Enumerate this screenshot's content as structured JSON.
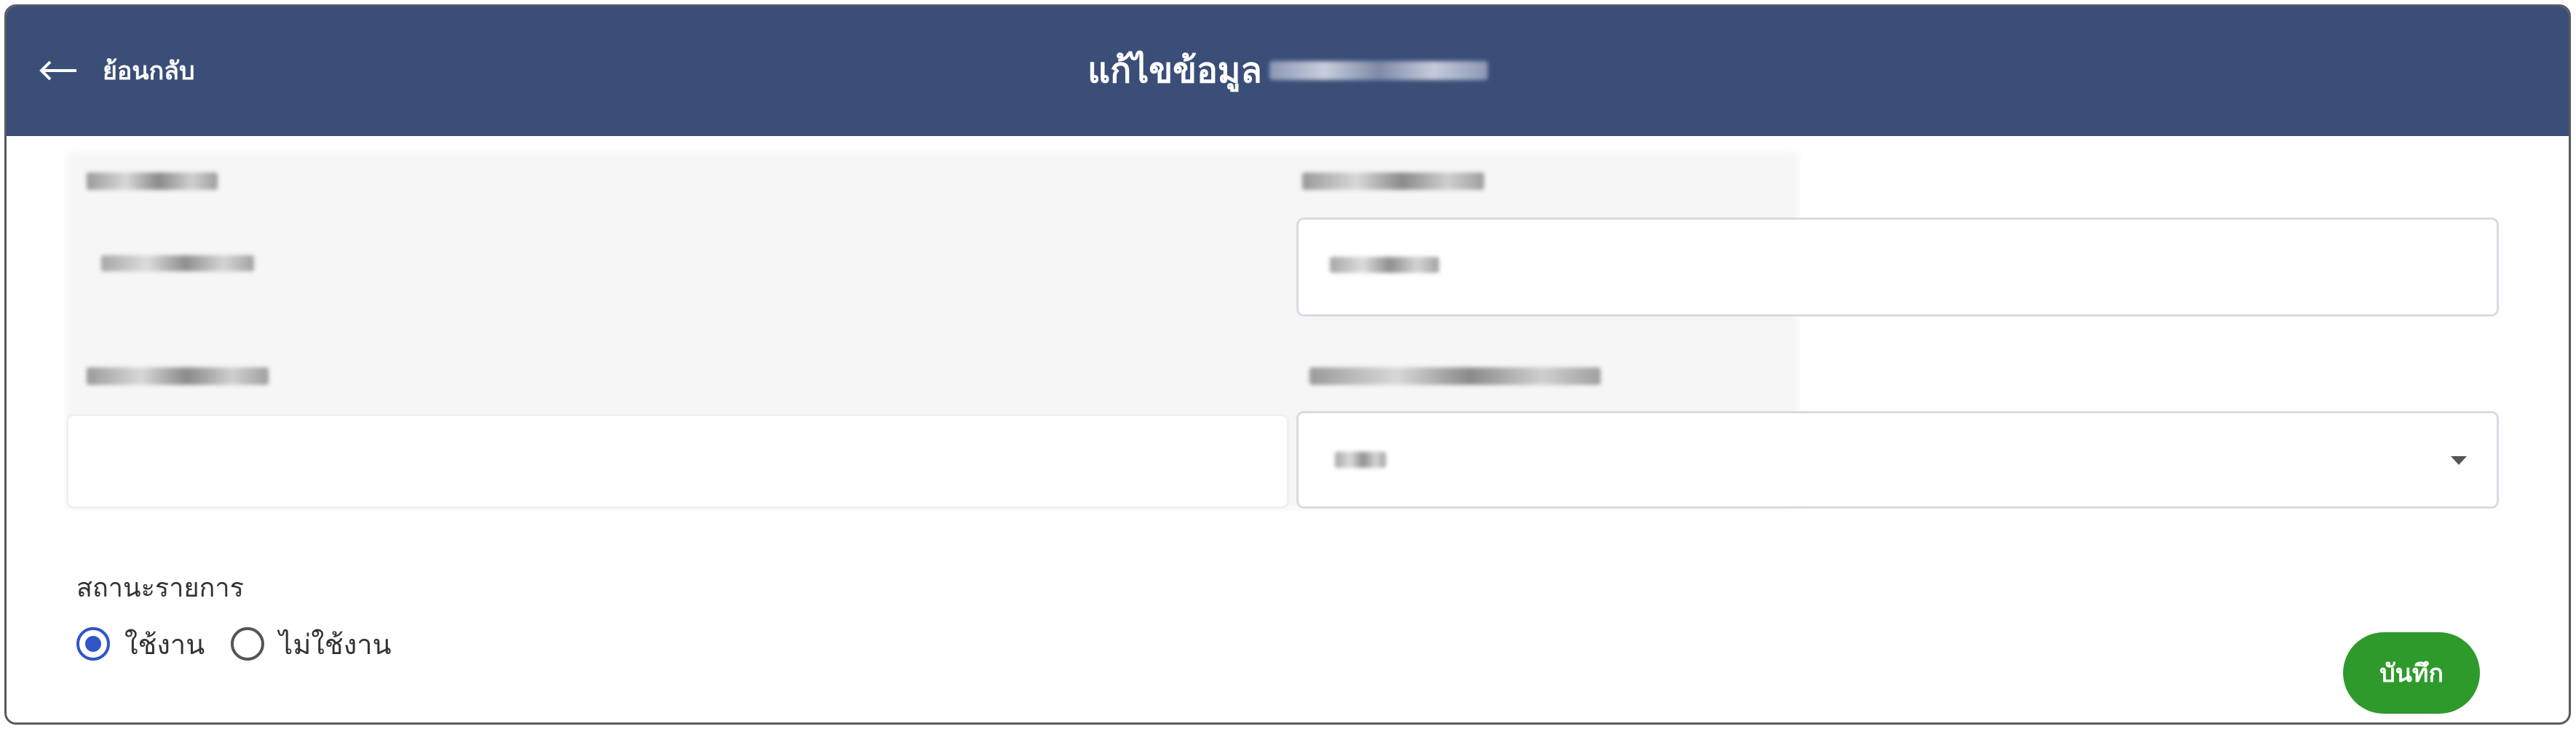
{
  "header": {
    "back_label": "ย้อนกลับ",
    "title": "แก้ไขข้อมูล"
  },
  "status": {
    "label": "สถานะรายการ",
    "options": [
      {
        "label": "ใช้งาน",
        "checked": true
      },
      {
        "label": "ไม่ใช้งาน",
        "checked": false
      }
    ]
  },
  "actions": {
    "save_label": "บันทึก"
  },
  "colors": {
    "header_bg": "#3a4e78",
    "accent_blue": "#2f55c8",
    "save_green": "#2d9a2b"
  },
  "icons": {
    "back": "arrow-left-icon",
    "dropdown": "caret-down-icon"
  }
}
